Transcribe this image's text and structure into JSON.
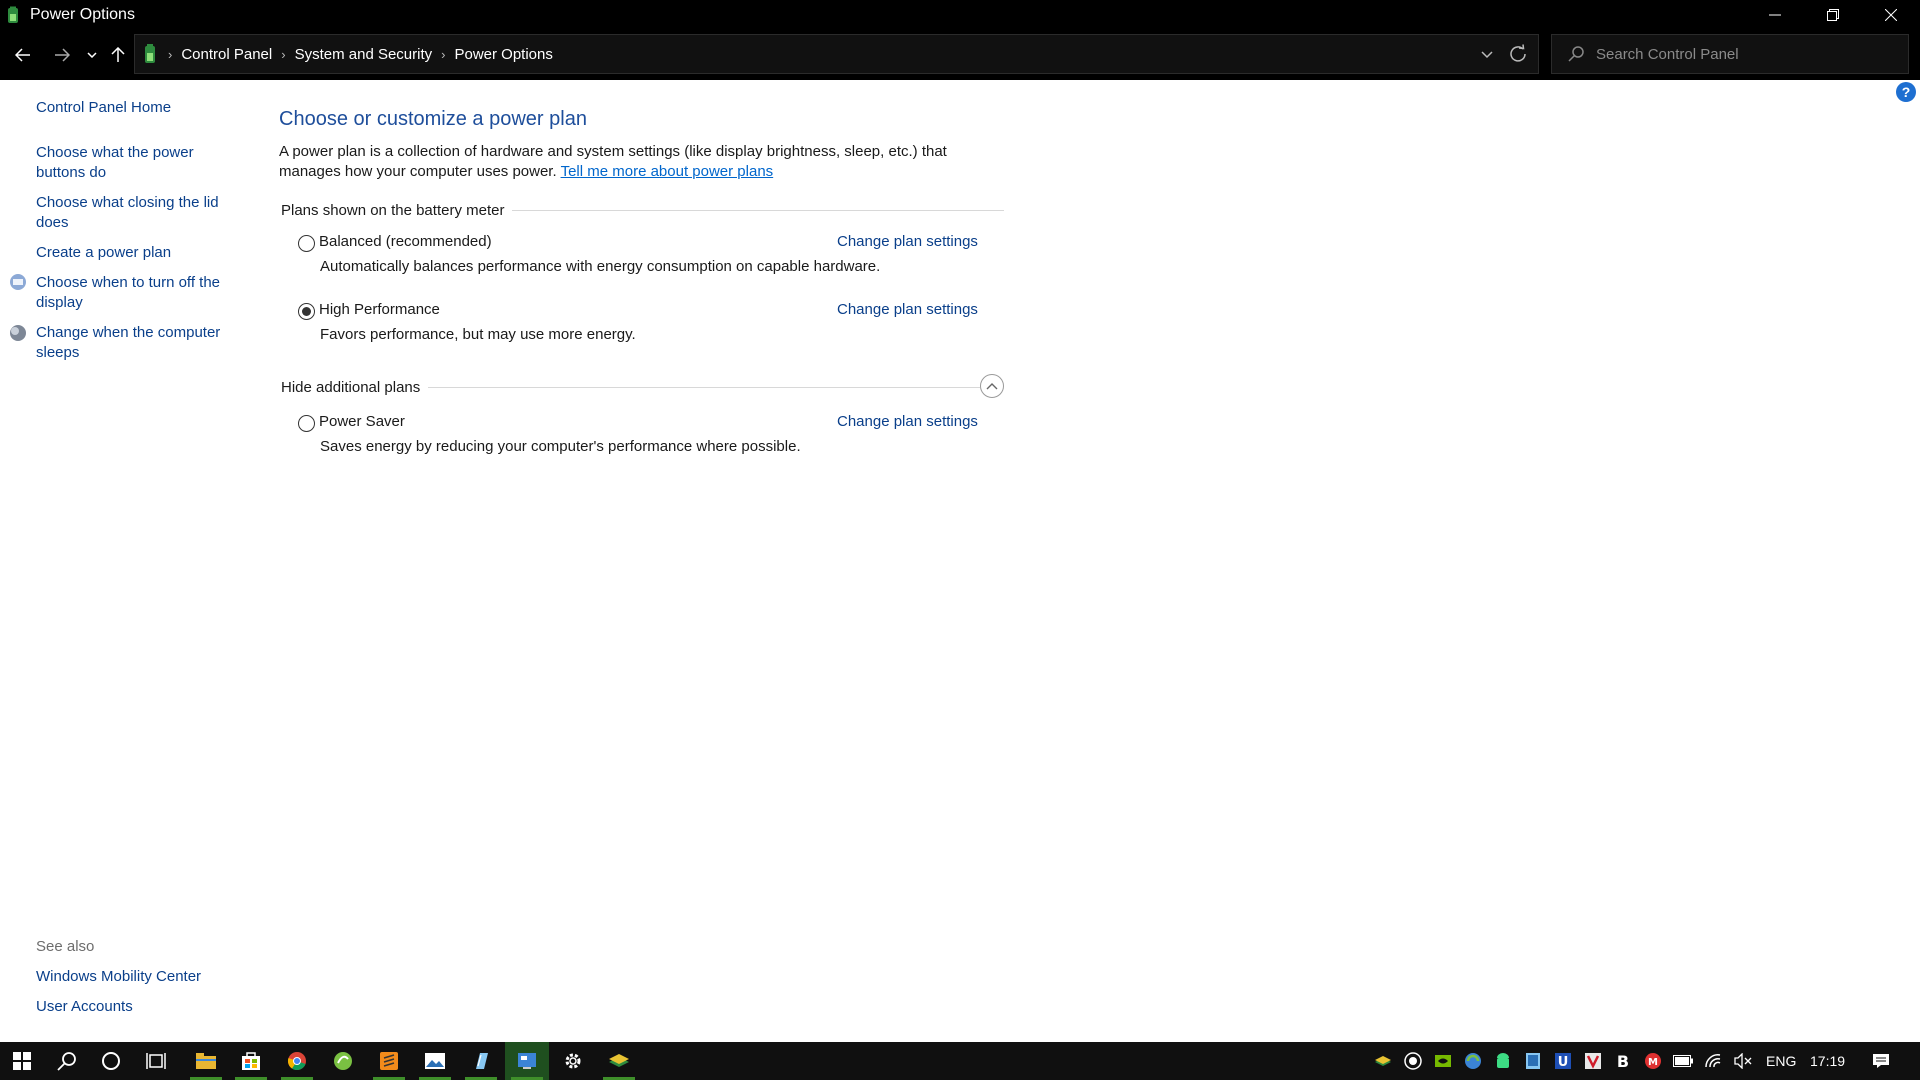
{
  "window": {
    "title": "Power Options",
    "minimize_label": "Minimize",
    "maximize_label": "Restore",
    "close_label": "Close"
  },
  "addressbar": {
    "crumbs": [
      "Control Panel",
      "System and Security",
      "Power Options"
    ],
    "search_placeholder": "Search Control Panel"
  },
  "leftpane": {
    "home": "Control Panel Home",
    "links": [
      "Choose what the power buttons do",
      "Choose what closing the lid does",
      "Create a power plan",
      "Choose when to turn off the display",
      "Change when the computer sleeps"
    ],
    "see_also": "See also",
    "see_also_links": [
      "Windows Mobility Center",
      "User Accounts"
    ]
  },
  "main": {
    "heading": "Choose or customize a power plan",
    "description": "A power plan is a collection of hardware and system settings (like display brightness, sleep, etc.) that manages how your computer uses power.",
    "learn_more": "Tell me more about power plans",
    "section_shown": "Plans shown on the battery meter",
    "section_hidden": "Hide additional plans",
    "change_label": "Change plan settings",
    "plans": [
      {
        "name": "Balanced (recommended)",
        "desc": "Automatically balances performance with energy consumption on capable hardware.",
        "selected": false
      },
      {
        "name": "High Performance",
        "desc": "Favors performance, but may use more energy.",
        "selected": true
      },
      {
        "name": "Power Saver",
        "desc": "Saves energy by reducing your computer's performance where possible.",
        "selected": false
      }
    ]
  },
  "taskbar": {
    "language": "ENG",
    "time": "17:19"
  },
  "colors": {
    "link": "#0a3f8a",
    "heading": "#1e4e9b",
    "titlebar": "#000000",
    "taskbar": "#101010",
    "active_indicator": "#3f8f2a"
  }
}
